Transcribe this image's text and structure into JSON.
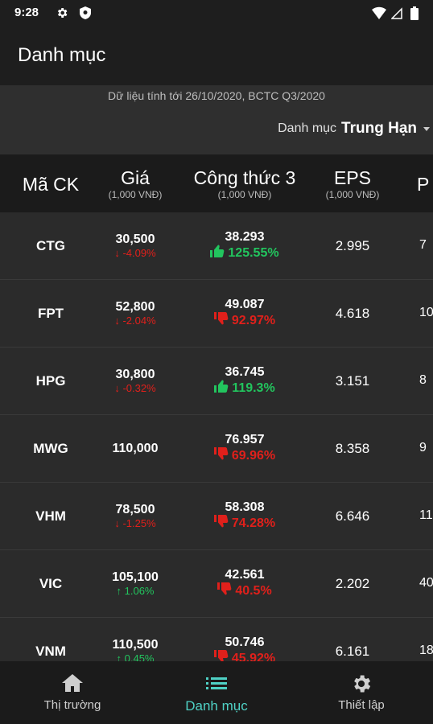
{
  "status_bar": {
    "time": "9:28"
  },
  "app_bar": {
    "title": "Danh mục"
  },
  "info": {
    "data_date": "Dữ liệu tính tới 26/10/2020, BCTC Q3/2020",
    "portfolio_label": "Danh mục",
    "portfolio_value": "Trung Hạn"
  },
  "columns": [
    {
      "title": "Mã CK",
      "unit": ""
    },
    {
      "title": "Giá",
      "unit": "(1,000 VNĐ)"
    },
    {
      "title": "Công thức 3",
      "unit": "(1,000 VNĐ)"
    },
    {
      "title": "EPS",
      "unit": "(1,000 VNĐ)"
    },
    {
      "title": "P",
      "unit": ""
    }
  ],
  "rows": [
    {
      "symbol": "CTG",
      "price": "30,500",
      "change": "-4.09%",
      "change_dir": "down",
      "formula": "38.293",
      "formula_pct": "125.55%",
      "formula_dir": "up",
      "eps": "2.995",
      "last": "7"
    },
    {
      "symbol": "FPT",
      "price": "52,800",
      "change": "-2.04%",
      "change_dir": "down",
      "formula": "49.087",
      "formula_pct": "92.97%",
      "formula_dir": "down",
      "eps": "4.618",
      "last": "10"
    },
    {
      "symbol": "HPG",
      "price": "30,800",
      "change": "-0.32%",
      "change_dir": "down",
      "formula": "36.745",
      "formula_pct": "119.3%",
      "formula_dir": "up",
      "eps": "3.151",
      "last": "8"
    },
    {
      "symbol": "MWG",
      "price": "110,000",
      "change": "",
      "change_dir": "none",
      "formula": "76.957",
      "formula_pct": "69.96%",
      "formula_dir": "down",
      "eps": "8.358",
      "last": "9"
    },
    {
      "symbol": "VHM",
      "price": "78,500",
      "change": "-1.25%",
      "change_dir": "down",
      "formula": "58.308",
      "formula_pct": "74.28%",
      "formula_dir": "down",
      "eps": "6.646",
      "last": "11"
    },
    {
      "symbol": "VIC",
      "price": "105,100",
      "change": "1.06%",
      "change_dir": "up",
      "formula": "42.561",
      "formula_pct": "40.5%",
      "formula_dir": "down",
      "eps": "2.202",
      "last": "40"
    },
    {
      "symbol": "VNM",
      "price": "110,500",
      "change": "0.45%",
      "change_dir": "up",
      "formula": "50.746",
      "formula_pct": "45.92%",
      "formula_dir": "down",
      "eps": "6.161",
      "last": "18"
    }
  ],
  "bottom_nav": [
    {
      "label": "Thị trường",
      "icon": "home-icon",
      "active": false
    },
    {
      "label": "Danh mục",
      "icon": "list-icon",
      "active": true
    },
    {
      "label": "Thiết lập",
      "icon": "gear-icon",
      "active": false
    }
  ],
  "colors": {
    "accent": "#4fd1c5",
    "down": "#e0201b",
    "up": "#22c55e"
  }
}
